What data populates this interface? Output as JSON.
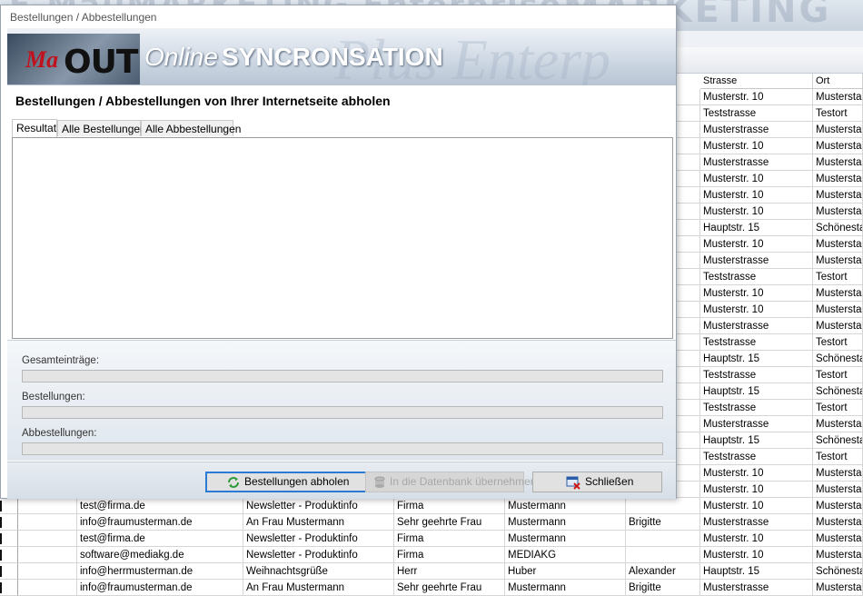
{
  "dialog": {
    "title": "Bestellungen / Abbestellungen",
    "header": {
      "logo_a": "Ma",
      "logo_b": "OUT",
      "subtitle_italic": "Online",
      "subtitle_bold": "SYNCRONSATION",
      "watermark": "Plus Enterp"
    },
    "heading": "Bestellungen / Abbestellungen von Ihrer Internetseite abholen",
    "tabs": [
      {
        "label": "Resultat",
        "active": true
      },
      {
        "label": "Alle Bestellungen",
        "active": false
      },
      {
        "label": "Alle Abbestellungen",
        "active": false
      }
    ],
    "stats": [
      {
        "label": "Gesamteinträge:",
        "progress": 0
      },
      {
        "label": "Bestellungen:",
        "progress": 0
      },
      {
        "label": "Abbestellungen:",
        "progress": 0
      }
    ],
    "buttons": {
      "fetch": "Bestellungen abholen",
      "import": "In die Datenbank übernehmen",
      "close": "Schließen"
    }
  },
  "background": {
    "banner_left": "E-MailMARKETING Enterprise",
    "banner_right": "MARKETING",
    "columns": [
      {
        "label": "Strasse"
      },
      {
        "label": "Ort"
      }
    ],
    "rows": [
      {
        "email": "",
        "betreff": "",
        "anrede": "",
        "name": "",
        "vorname": "",
        "strasse": "Musterstr. 10",
        "ort": "Musterstadt"
      },
      {
        "email": "",
        "betreff": "",
        "anrede": "",
        "name": "",
        "vorname": "",
        "strasse": "Teststrasse",
        "ort": "Testort"
      },
      {
        "email": "",
        "betreff": "",
        "anrede": "",
        "name": "",
        "vorname": "",
        "strasse": "Musterstrasse",
        "ort": "Musterstadt"
      },
      {
        "email": "",
        "betreff": "",
        "anrede": "",
        "name": "",
        "vorname": "",
        "strasse": "Musterstr. 10",
        "ort": "Musterstadt"
      },
      {
        "email": "",
        "betreff": "",
        "anrede": "",
        "name": "",
        "vorname": "",
        "strasse": "Musterstrasse",
        "ort": "Musterstadt"
      },
      {
        "email": "",
        "betreff": "",
        "anrede": "",
        "name": "",
        "vorname": "",
        "strasse": "Musterstr. 10",
        "ort": "Musterstadt"
      },
      {
        "email": "",
        "betreff": "",
        "anrede": "",
        "name": "",
        "vorname": "",
        "strasse": "Musterstr. 10",
        "ort": "Musterstadt"
      },
      {
        "email": "",
        "betreff": "",
        "anrede": "",
        "name": "",
        "vorname": "",
        "strasse": "Musterstr. 10",
        "ort": "Musterstadt"
      },
      {
        "email": "",
        "betreff": "",
        "anrede": "",
        "name": "",
        "vorname": "",
        "strasse": "Hauptstr. 15",
        "ort": "Schönestadt"
      },
      {
        "email": "",
        "betreff": "",
        "anrede": "",
        "name": "",
        "vorname": "",
        "strasse": "Musterstr. 10",
        "ort": "Musterstadt"
      },
      {
        "email": "",
        "betreff": "",
        "anrede": "",
        "name": "",
        "vorname": "",
        "strasse": "Musterstrasse",
        "ort": "Musterstadt"
      },
      {
        "email": "",
        "betreff": "",
        "anrede": "",
        "name": "",
        "vorname": "",
        "strasse": "Teststrasse",
        "ort": "Testort"
      },
      {
        "email": "",
        "betreff": "",
        "anrede": "",
        "name": "",
        "vorname": "",
        "strasse": "Musterstr. 10",
        "ort": "Musterstadt"
      },
      {
        "email": "",
        "betreff": "",
        "anrede": "",
        "name": "",
        "vorname": "",
        "strasse": "Musterstr. 10",
        "ort": "Musterstadt"
      },
      {
        "email": "",
        "betreff": "",
        "anrede": "",
        "name": "",
        "vorname": "",
        "strasse": "Musterstrasse",
        "ort": "Musterstadt"
      },
      {
        "email": "",
        "betreff": "",
        "anrede": "",
        "name": "",
        "vorname": "",
        "strasse": "Teststrasse",
        "ort": "Testort"
      },
      {
        "email": "",
        "betreff": "",
        "anrede": "",
        "name": "",
        "vorname": "",
        "strasse": "Hauptstr. 15",
        "ort": "Schönestadt"
      },
      {
        "email": "",
        "betreff": "",
        "anrede": "",
        "name": "",
        "vorname": "",
        "strasse": "Teststrasse",
        "ort": "Testort"
      },
      {
        "email": "",
        "betreff": "",
        "anrede": "",
        "name": "",
        "vorname": "",
        "strasse": "Hauptstr. 15",
        "ort": "Schönestadt"
      },
      {
        "email": "",
        "betreff": "",
        "anrede": "",
        "name": "",
        "vorname": "",
        "strasse": "Teststrasse",
        "ort": "Testort"
      },
      {
        "email": "",
        "betreff": "",
        "anrede": "",
        "name": "",
        "vorname": "",
        "strasse": "Musterstrasse",
        "ort": "Musterstadt"
      },
      {
        "email": "",
        "betreff": "",
        "anrede": "",
        "name": "",
        "vorname": "",
        "strasse": "Hauptstr. 15",
        "ort": "Schönestadt"
      },
      {
        "email": "",
        "betreff": "",
        "anrede": "",
        "name": "",
        "vorname": "",
        "strasse": "Teststrasse",
        "ort": "Testort"
      },
      {
        "email": "",
        "betreff": "",
        "anrede": "",
        "name": "",
        "vorname": "",
        "strasse": "Musterstr. 10",
        "ort": "Musterstadt"
      },
      {
        "email": "",
        "betreff": "",
        "anrede": "",
        "name": "",
        "vorname": "",
        "strasse": "Musterstr. 10",
        "ort": "Musterstadt"
      },
      {
        "email": "test@firma.de",
        "betreff": "Newsletter - Produktinfo",
        "anrede": "Firma",
        "name": "Mustermann",
        "vorname": "",
        "strasse": "Musterstr. 10",
        "ort": "Musterstadt"
      },
      {
        "email": "info@fraumusterman.de",
        "betreff": "An Frau Mustermann",
        "anrede": "Sehr geehrte Frau",
        "name": "Mustermann",
        "vorname": "Brigitte",
        "strasse": "Musterstrasse",
        "ort": "Musterstadt"
      },
      {
        "email": "test@firma.de",
        "betreff": "Newsletter - Produktinfo",
        "anrede": "Firma",
        "name": "Mustermann",
        "vorname": "",
        "strasse": "Musterstr. 10",
        "ort": "Musterstadt"
      },
      {
        "email": "software@mediakg.de",
        "betreff": "Newsletter - Produktinfo",
        "anrede": "Firma",
        "name": "MEDIAKG",
        "vorname": "",
        "strasse": "Musterstr. 10",
        "ort": "Musterstadt"
      },
      {
        "email": "info@herrmusterman.de",
        "betreff": "Weihnachtsgrüße",
        "anrede": "Herr",
        "name": "Huber",
        "vorname": "Alexander",
        "strasse": "Hauptstr. 15",
        "ort": "Schönestadt"
      },
      {
        "email": "info@fraumusterman.de",
        "betreff": "An Frau Mustermann",
        "anrede": "Sehr geehrte Frau",
        "name": "Mustermann",
        "vorname": "Brigitte",
        "strasse": "Musterstrasse",
        "ort": "Musterstadt"
      }
    ]
  },
  "colors": {
    "accent": "#2b7bd6",
    "progress_fill": "#06b025"
  }
}
